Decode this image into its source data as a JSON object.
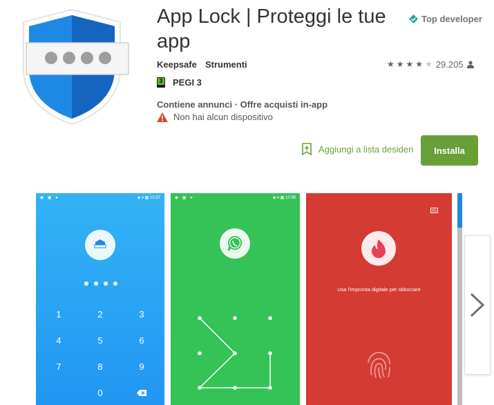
{
  "app": {
    "title": "App Lock | Proteggi le tue app",
    "developer": "Keepsafe",
    "category": "Strumenti",
    "badge": "Top developer",
    "rating_stars": 4,
    "rating_count": "29.205",
    "pegi_label": "PEGI 3",
    "pegi_number": "3",
    "ads_notice": "Contiene annunci · Offre acquisti in-app",
    "device_warning": "Non hai alcun dispositivo"
  },
  "actions": {
    "wishlist_label": "Aggiungi a lista desideri",
    "install_label": "Installa"
  },
  "screenshots": {
    "shot1": {
      "time": "10:37",
      "keys": [
        "1",
        "2",
        "3",
        "4",
        "5",
        "6",
        "7",
        "8",
        "9",
        "0"
      ]
    },
    "shot2": {
      "time": "10:38"
    },
    "shot3": {
      "caption": "Usa l'impronta digitale per sbloccare"
    }
  },
  "colors": {
    "accent_green": "#689f38",
    "shot_blue": "#2196f3",
    "shot_green": "#35c257",
    "shot_red": "#d43b33",
    "shield_blue": "#1e88e5"
  },
  "icons": [
    "shield-lock-icon",
    "top-developer-icon",
    "star-icon",
    "person-icon",
    "pegi-icon",
    "warning-icon",
    "bookmark-add-icon",
    "whatsapp-icon",
    "tinder-flame-icon",
    "fingerprint-icon",
    "backspace-icon",
    "chevron-right-icon"
  ]
}
